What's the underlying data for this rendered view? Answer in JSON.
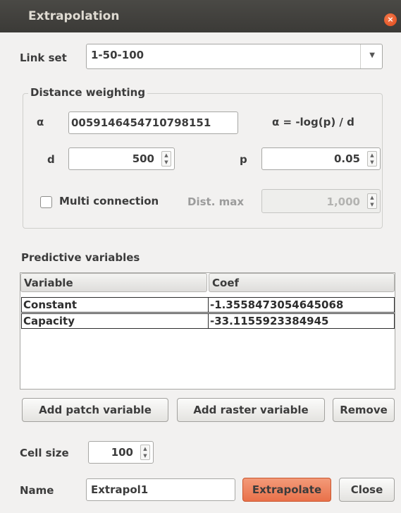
{
  "window": {
    "title": "Extrapolation",
    "close_glyph": "×"
  },
  "link_set": {
    "label": "Link set",
    "value": "1-50-100"
  },
  "distance_weighting": {
    "title": "Distance weighting",
    "alpha_label": "α",
    "alpha_value": "0059146454710798151",
    "formula": "α = -log(p) / d",
    "d_label": "d",
    "d_value": "500",
    "p_label": "p",
    "p_value": "0.05",
    "multi_connection_label": "Multi connection",
    "multi_connection_checked": false,
    "dist_max_label": "Dist. max",
    "dist_max_value": "1,000"
  },
  "predictive": {
    "title": "Predictive variables",
    "columns": [
      "Variable",
      "Coef"
    ],
    "rows": [
      [
        "Constant",
        "-1.3558473054645068"
      ],
      [
        "Capacity",
        "-33.1155923384945"
      ]
    ],
    "add_patch_label": "Add patch variable",
    "add_raster_label": "Add raster variable",
    "remove_label": "Remove"
  },
  "cell_size": {
    "label": "Cell size",
    "value": "100"
  },
  "name": {
    "label": "Name",
    "value": "Extrapol1"
  },
  "actions": {
    "extrapolate_label": "Extrapolate",
    "close_label": "Close"
  },
  "colors": {
    "accent": "#e9714a",
    "titlebar": "#3b3a37",
    "background": "#f2f1f0"
  }
}
